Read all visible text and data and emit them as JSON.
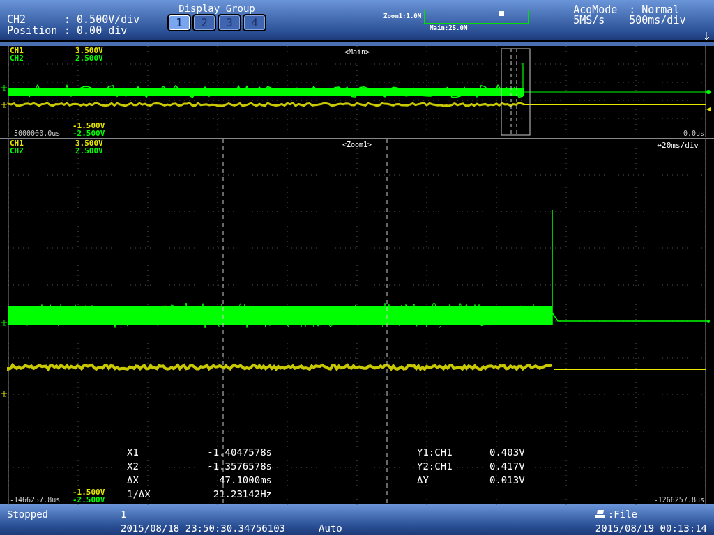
{
  "header": {
    "channel_info": [
      {
        "label": "CH2",
        "value": ": 0.500V/div"
      },
      {
        "label": "Position",
        "value": ": 0.00 div"
      }
    ],
    "display_group": {
      "title": "Display Group",
      "buttons": [
        {
          "label": "1",
          "selected": true
        },
        {
          "label": "2",
          "selected": false
        },
        {
          "label": "3",
          "selected": false
        },
        {
          "label": "4",
          "selected": false
        }
      ]
    },
    "zoom_bar": {
      "zoom_label": "Zoom1:1.0M",
      "main_label": "Main:25.0M",
      "level": 0.72
    },
    "acquisition": {
      "mode_label": "AcqMode",
      "mode_value": ": Normal",
      "sample_rate": "5MS/s",
      "timebase": "500ms/div"
    }
  },
  "main_panel": {
    "title": "<Main>",
    "top_scale": [
      {
        "name": "CH1",
        "value": "3.500V",
        "color": "#e8e800"
      },
      {
        "name": "CH2",
        "value": "2.500V",
        "color": "#00ff00"
      }
    ],
    "bottom_scale": [
      {
        "value": "-1.500V",
        "color": "#e8e800"
      },
      {
        "value": "-2.500V",
        "color": "#00ff00"
      }
    ],
    "time_start": "-5000000.0us",
    "time_end": "0.0us"
  },
  "zoom_panel": {
    "title": "<Zoom1>",
    "timebase": "↔20ms/div",
    "top_scale": [
      {
        "name": "CH1",
        "value": "3.500V",
        "color": "#e8e800"
      },
      {
        "name": "CH2",
        "value": "2.500V",
        "color": "#00ff00"
      }
    ],
    "bottom_scale": [
      {
        "value": "-1.500V",
        "color": "#e8e800"
      },
      {
        "value": "-2.500V",
        "color": "#00ff00"
      }
    ],
    "time_start": "-1466257.8us",
    "time_end": "-1266257.8us",
    "x_cursors": [
      {
        "label": "X1",
        "value": "-1.4047578s"
      },
      {
        "label": "X2",
        "value": "-1.3576578s"
      },
      {
        "label": "ΔX",
        "value": "47.1000ms"
      },
      {
        "label": "1/ΔX",
        "value": "21.23142Hz"
      }
    ],
    "y_cursors": [
      {
        "label": "Y1:CH1",
        "value": "0.403V"
      },
      {
        "label": "Y2:CH1",
        "value": "0.417V"
      },
      {
        "label": "ΔY",
        "value": "0.013V"
      }
    ]
  },
  "status_bar": {
    "state": "Stopped",
    "count": "1",
    "trigger_time": "2015/08/18 23:50:30.34756103",
    "trigger_mode": "Auto",
    "save_target": ":File",
    "clock": "2015/08/19 00:13:14"
  }
}
